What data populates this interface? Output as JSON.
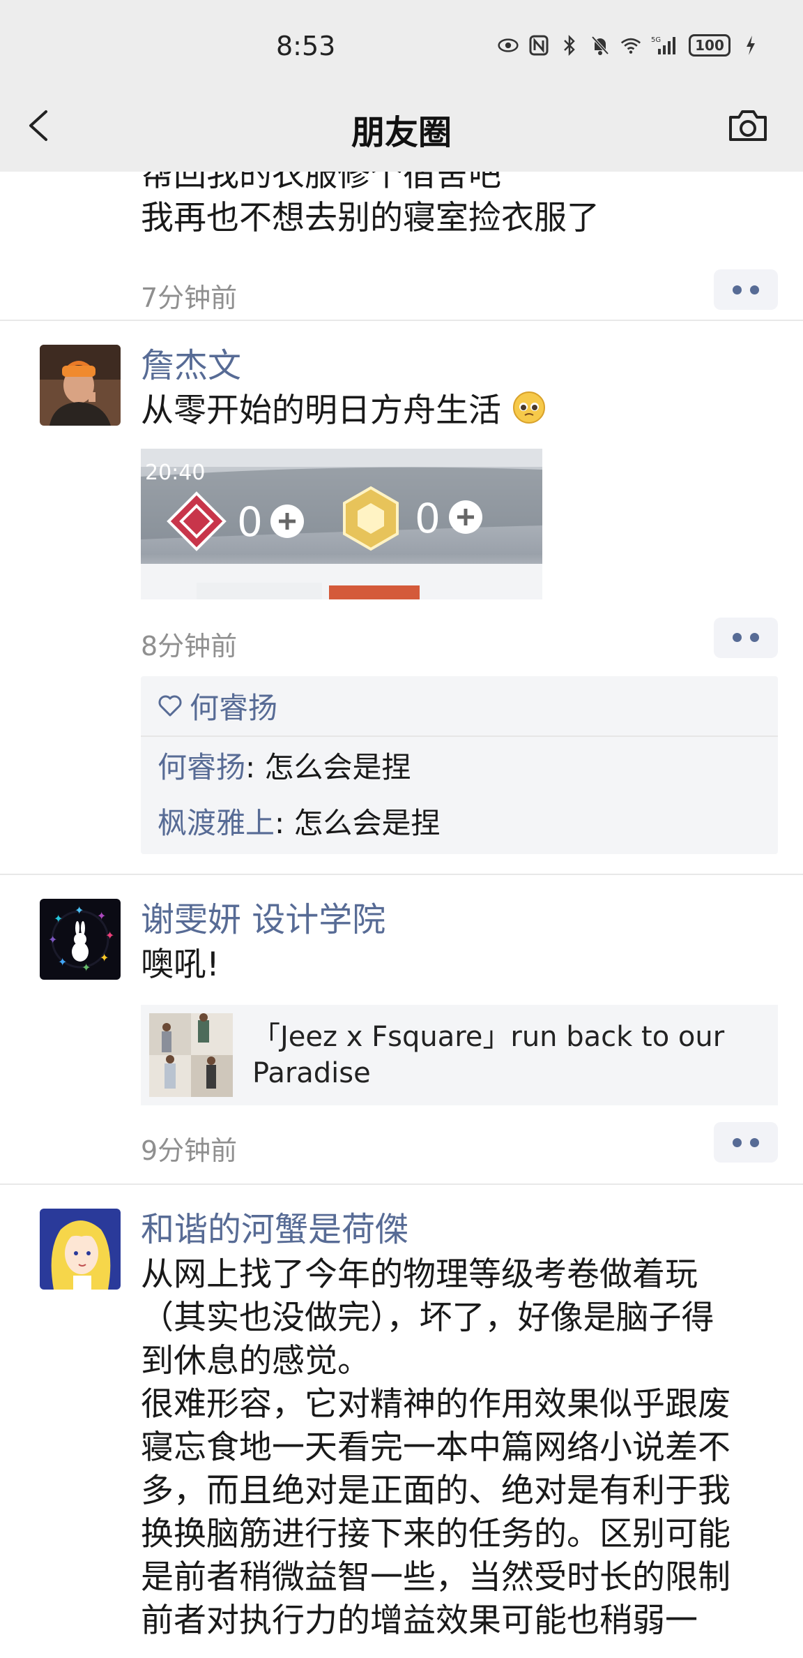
{
  "status_bar": {
    "time": "8:53",
    "battery": "100",
    "network": "5G"
  },
  "nav": {
    "title": "朋友圈"
  },
  "posts": [
    {
      "text_lines": [
        "帮回我的衣服修个宿舍吧",
        "我再也不想去别的寝室捡衣服了"
      ],
      "time": "7分钟前"
    },
    {
      "author": "詹杰文",
      "text": "从零开始的明日方舟生活",
      "image_text": {
        "clock": "20:40",
        "count1": "0",
        "count2": "0"
      },
      "time": "8分钟前",
      "likes": "何睿扬",
      "comments": [
        {
          "name": "何睿扬",
          "text": ": 怎么会是捏"
        },
        {
          "name": "枫渡雅上",
          "text": ": 怎么会是捏"
        }
      ]
    },
    {
      "author": "谢雯妍 设计学院",
      "text": "噢吼!",
      "link_title": "「Jeez x Fsquare」run back to our Paradise",
      "time": "9分钟前"
    },
    {
      "author": "和谐的河蟹是荷傑",
      "text_lines": [
        "从网上找了今年的物理等级考卷做着玩",
        "（其实也没做完），坏了，好像是脑子得",
        "到休息的感觉。",
        "很难形容，它对精神的作用效果似乎跟废",
        "寝忘食地一天看完一本中篇网络小说差不",
        "多，而且绝对是正面的、绝对是有利于我",
        "换换脑筋进行接下来的任务的。区别可能",
        "是前者稍微益智一些，当然受时长的限制",
        "前者对执行力的增益效果可能也稍弱一"
      ]
    }
  ]
}
